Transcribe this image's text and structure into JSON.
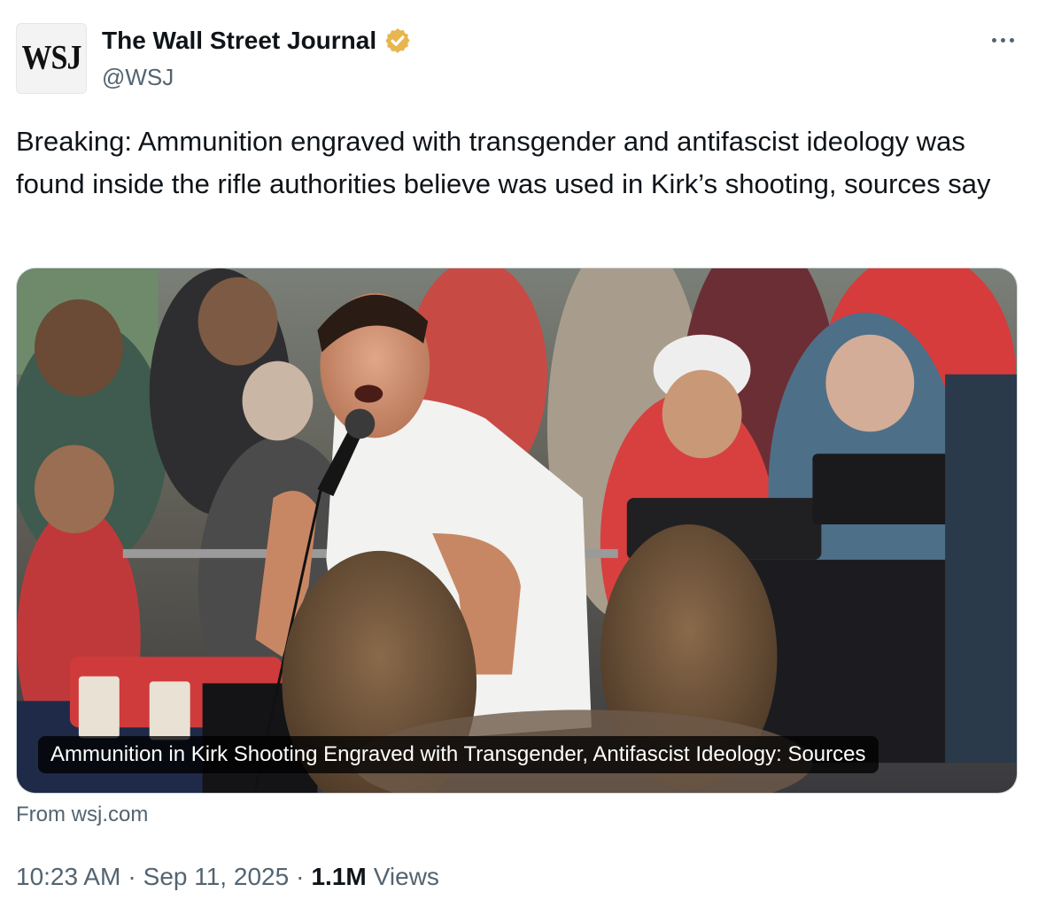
{
  "author": {
    "avatar_text": "WSJ",
    "display_name": "The Wall Street Journal",
    "handle": "@WSJ",
    "verified": true,
    "badge_color": "#e5b34b"
  },
  "tweet": {
    "text": "Breaking: Ammunition engraved with transgender and antifascist ideology was found inside the rifle authorities believe was used in Kirk’s shooting, sources say"
  },
  "card": {
    "image_icon": "news-photo-speaker-with-microphone",
    "caption": "Ammunition in Kirk Shooting Engraved with Transgender, Antifascist Ideology: Sources",
    "source_prefix": "From",
    "source_domain": "wsj.com"
  },
  "meta": {
    "time": "10:23 AM",
    "date": "Sep 11, 2025",
    "separator": "·",
    "views_count": "1.1M",
    "views_label": "Views"
  },
  "colors": {
    "text_primary": "#0f1419",
    "text_secondary": "#536471",
    "border": "#cfd9de"
  }
}
